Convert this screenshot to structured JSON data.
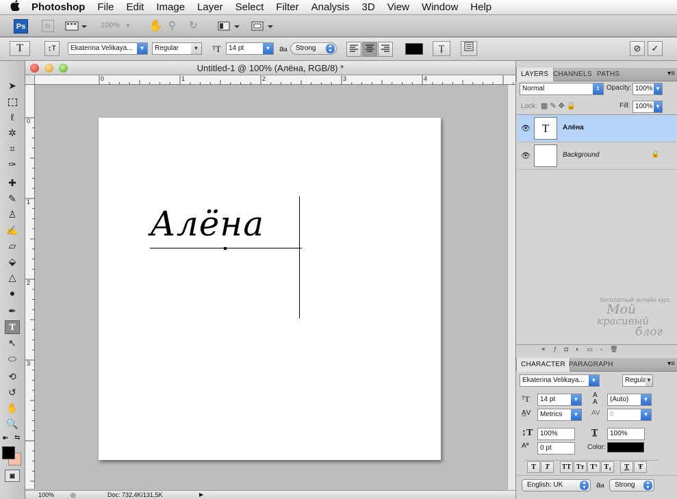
{
  "menubar": {
    "app_name": "Photoshop",
    "items": [
      "File",
      "Edit",
      "Image",
      "Layer",
      "Select",
      "Filter",
      "Analysis",
      "3D",
      "View",
      "Window",
      "Help"
    ]
  },
  "appbar": {
    "ps_label": "Ps",
    "br_label": "Br",
    "zoom": "100%"
  },
  "options": {
    "tool_glyph": "T",
    "font_family": "Ekaterina Velikaya...",
    "font_style": "Regular",
    "font_size": "14 pt",
    "aa_label": "a",
    "antialias": "Strong",
    "text_color": "#000000"
  },
  "document": {
    "title": "Untitled-1 @ 100% (Алёна, RGB/8) *",
    "text": "Алёна",
    "ruler_h": [
      "0",
      "1",
      "2",
      "3",
      "4"
    ],
    "ruler_v": [
      "0",
      "1",
      "2",
      "3"
    ],
    "zoom": "100%",
    "doc_info": "Doc: 732,4K/131,5K"
  },
  "layers_panel": {
    "tabs": [
      "LAYERS",
      "CHANNELS",
      "PATHS"
    ],
    "blend_mode": "Normal",
    "opacity_label": "Opacity:",
    "opacity": "100%",
    "lock_label": "Lock:",
    "fill_label": "Fill:",
    "fill": "100%",
    "layers": [
      {
        "name": "Алёна",
        "thumb": "T",
        "selected": true
      },
      {
        "name": "Background",
        "thumb": "",
        "selected": false
      }
    ]
  },
  "watermark": {
    "line1": "бесплатный онлайн курс",
    "line2": "Мой",
    "line3": "красивый",
    "line4": "блог"
  },
  "character_panel": {
    "tabs": [
      "CHARACTER",
      "PARAGRAPH"
    ],
    "font_family": "Ekaterina Velikaya...",
    "font_style": "Regular",
    "size": "14 pt",
    "leading": "(Auto)",
    "kerning": "Metrics",
    "tracking": "0",
    "vscale": "100%",
    "hscale": "100%",
    "baseline": "0 pt",
    "color_label": "Color:",
    "color": "#000000",
    "language": "English: UK",
    "antialias": "Strong",
    "style_buttons": [
      "T",
      "T",
      "TT",
      "Tт",
      "T¹",
      "T₁",
      "T",
      "Ŧ"
    ]
  },
  "colors": {
    "foreground": "#000000",
    "background": "#f5bfa8",
    "selection": "#b5d4f7",
    "accent_red": "#e8401c"
  }
}
